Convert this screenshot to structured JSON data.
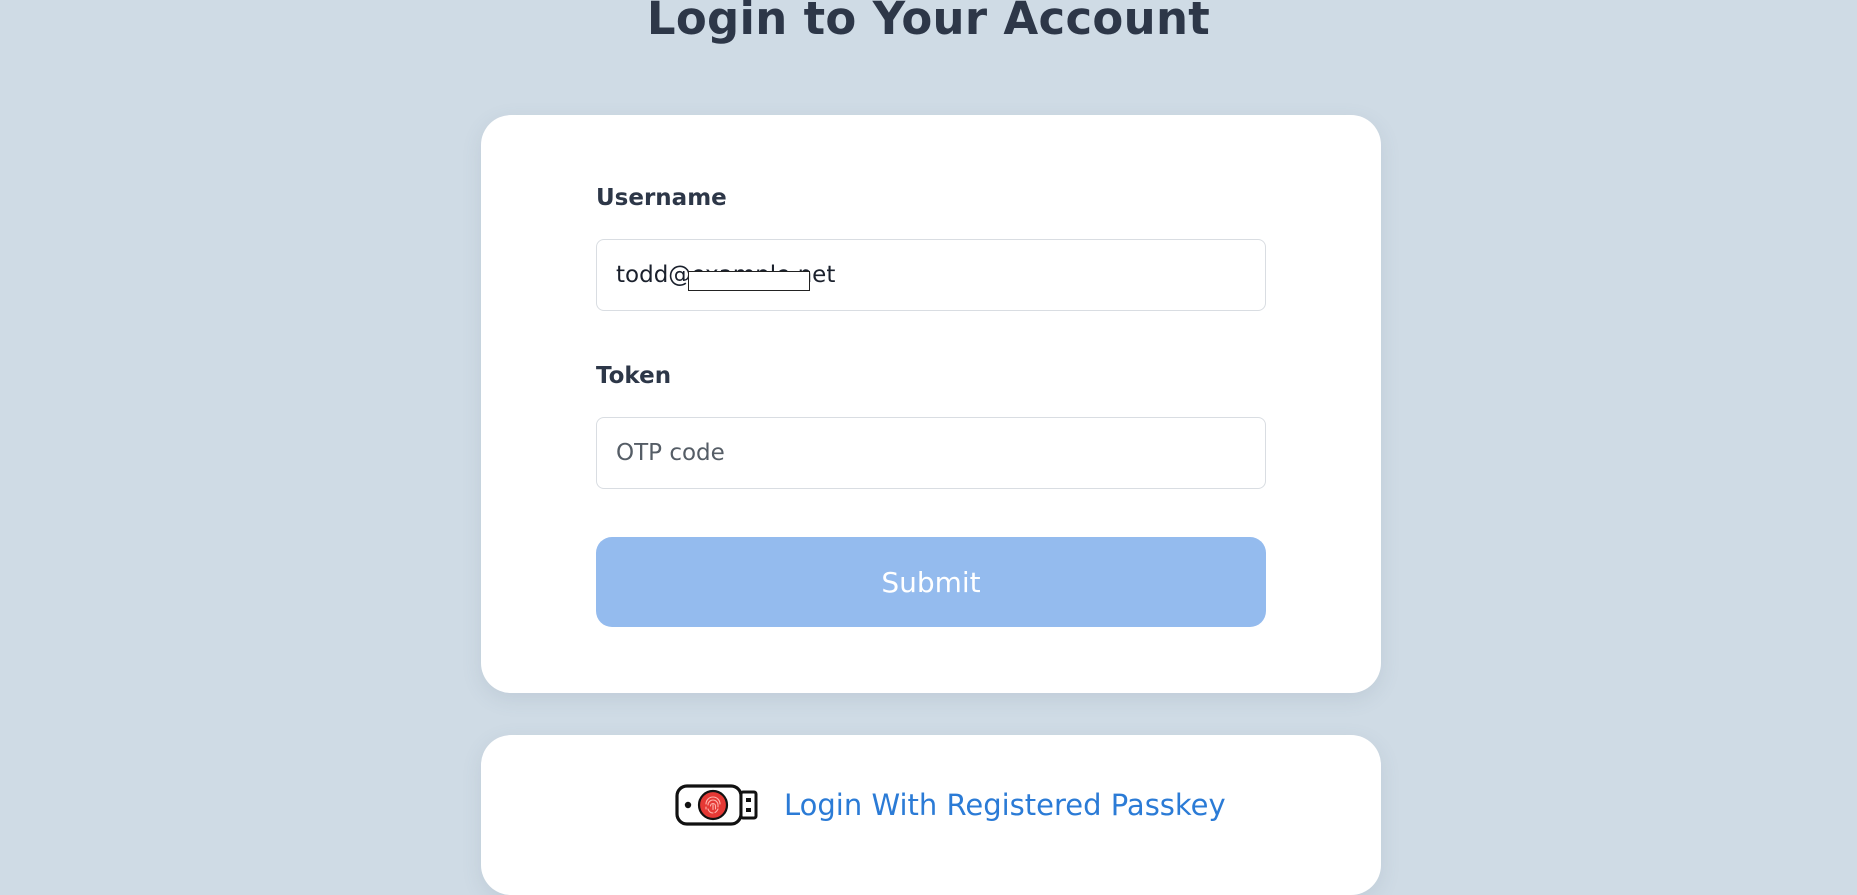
{
  "page": {
    "title": "Login to Your Account"
  },
  "login_form": {
    "username_label": "Username",
    "username_value": "todd@example.net",
    "token_label": "Token",
    "token_placeholder": "OTP code",
    "token_value": "",
    "submit_label": "Submit",
    "submit_enabled": false
  },
  "passkey": {
    "link_label": "Login With Registered Passkey",
    "icon": "usb-security-key-icon"
  },
  "colors": {
    "background": "#cfdbe5",
    "card": "#ffffff",
    "heading_text": "#2d3748",
    "submit_disabled": "#94bbee",
    "link": "#2b7bd6",
    "fingerprint": "#e53935"
  }
}
